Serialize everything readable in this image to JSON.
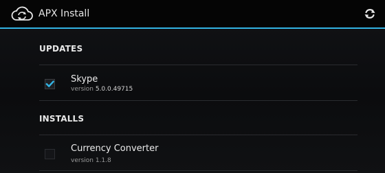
{
  "action_bar": {
    "title": "APX Install",
    "app_icon": "cloud-sync-icon",
    "refresh_icon": "refresh-icon",
    "accent_color": "#33b5e5"
  },
  "sections": {
    "updates": {
      "header": "UPDATES",
      "items": [
        {
          "name": "Skype",
          "version_prefix": "version",
          "version": "5.0.0.49715",
          "checked": true
        }
      ]
    },
    "installs": {
      "header": "INSTALLS",
      "items": [
        {
          "name": "Currency Converter",
          "version_prefix": "version",
          "version": "1.1.8",
          "checked": false
        }
      ]
    }
  },
  "colors": {
    "check_mark": "#33b5e5",
    "background": "#0d0e10"
  }
}
